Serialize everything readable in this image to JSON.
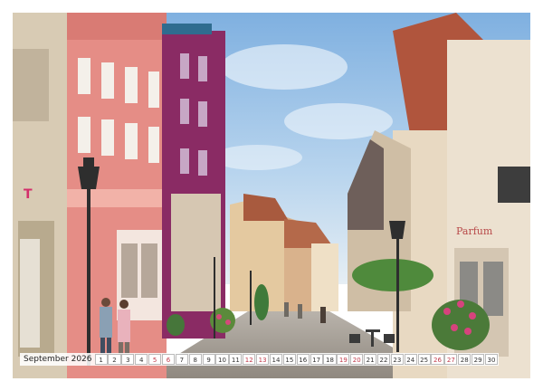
{
  "calendar": {
    "month_label": "September 2026",
    "days": [
      "1",
      "2",
      "3",
      "4",
      "5",
      "6",
      "7",
      "8",
      "9",
      "10",
      "11",
      "12",
      "13",
      "14",
      "15",
      "16",
      "17",
      "18",
      "19",
      "20",
      "21",
      "22",
      "23",
      "24",
      "25",
      "26",
      "27",
      "28",
      "29",
      "30"
    ],
    "weekend_days": [
      "5",
      "6",
      "12",
      "13",
      "19",
      "20",
      "26",
      "27"
    ]
  },
  "photo": {
    "subject": "old-town-street",
    "shop_sign": "Parfum"
  },
  "colors": {
    "sky": "#9dc3e6",
    "pink_facade": "#e58d86",
    "purple_facade": "#8a2b64",
    "weekend_text": "#c03a4a"
  }
}
